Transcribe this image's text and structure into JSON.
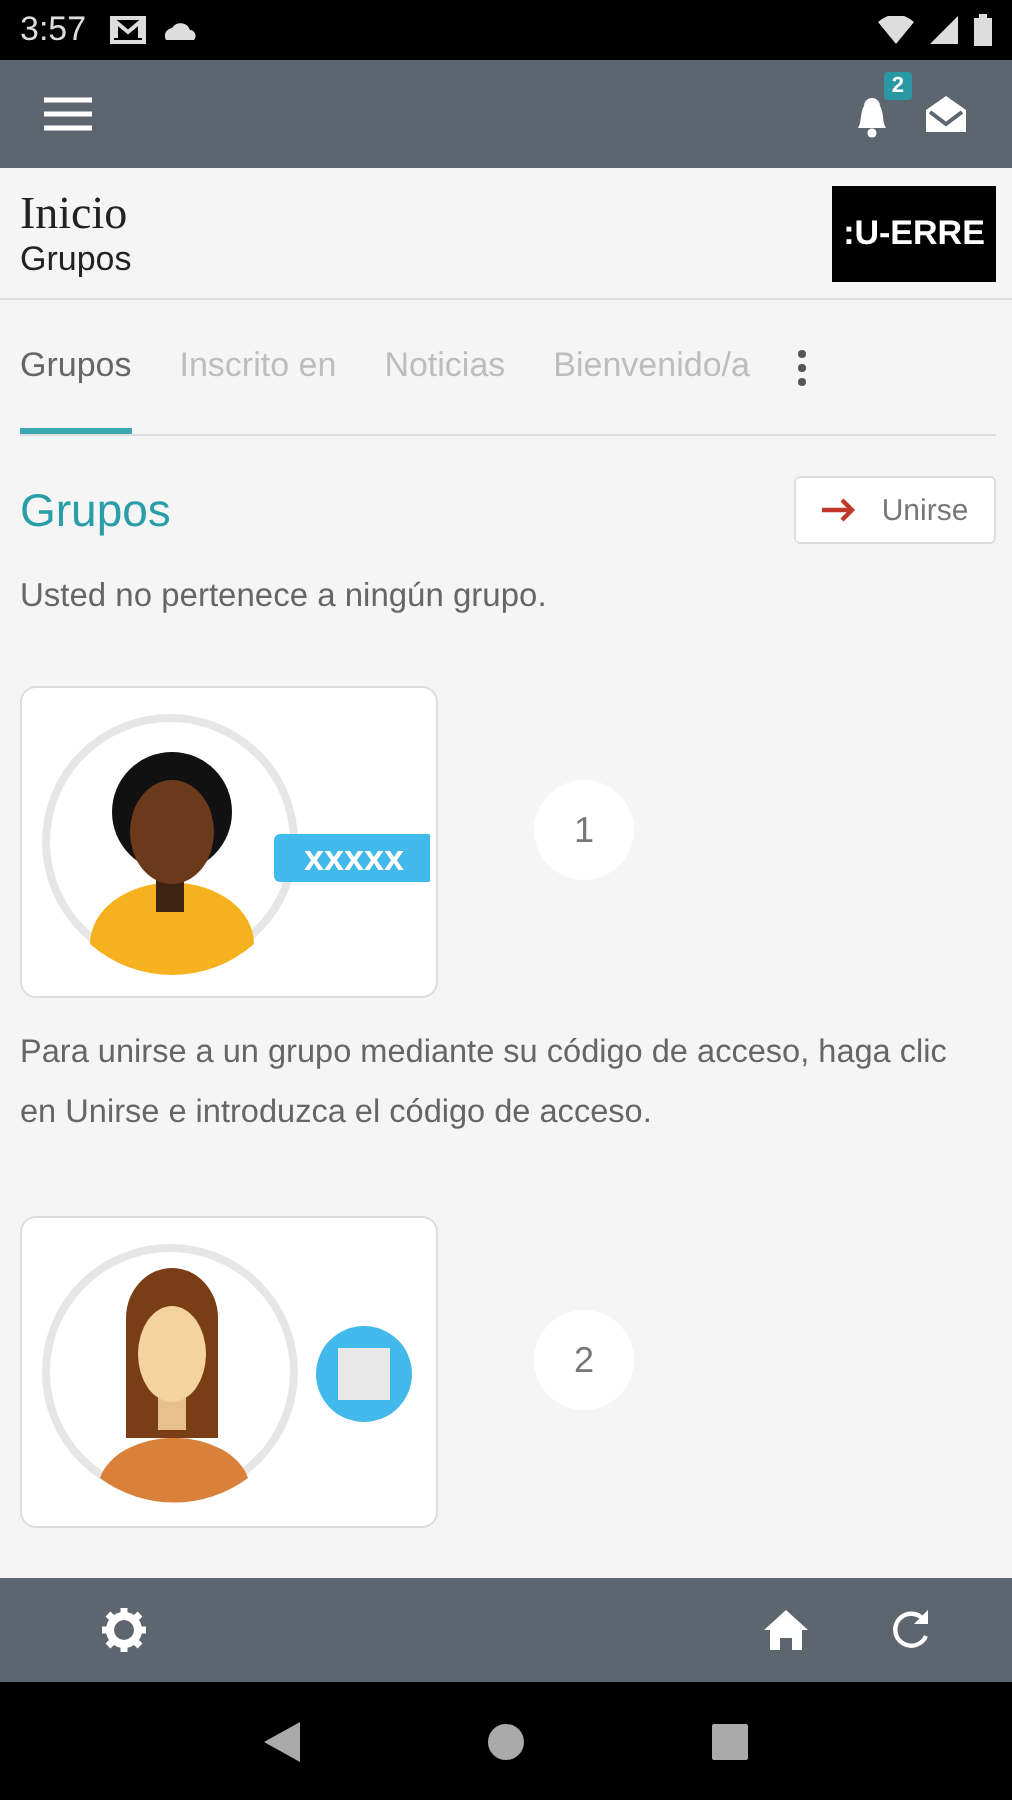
{
  "status_bar": {
    "time": "3:57"
  },
  "app_bar": {
    "notification_count": "2"
  },
  "header": {
    "title": "Inicio",
    "subtitle": "Grupos",
    "logo": ":U-ERRE"
  },
  "tabs": [
    {
      "label": "Grupos",
      "selected": true
    },
    {
      "label": "Inscrito en",
      "selected": false
    },
    {
      "label": "Noticias",
      "selected": false
    },
    {
      "label": "Bienvenido/a",
      "selected": false
    }
  ],
  "section": {
    "title": "Grupos",
    "join_button": "Unirse",
    "message": "Usted no pertenece a ningún grupo."
  },
  "steps": [
    {
      "kind": "code",
      "badge": "xxxxx",
      "number": "1",
      "text": "Para unirse a un grupo mediante su código de acceso, haga clic en Unirse e introduzca el código de acceso."
    },
    {
      "kind": "catalog",
      "number": "2"
    }
  ]
}
